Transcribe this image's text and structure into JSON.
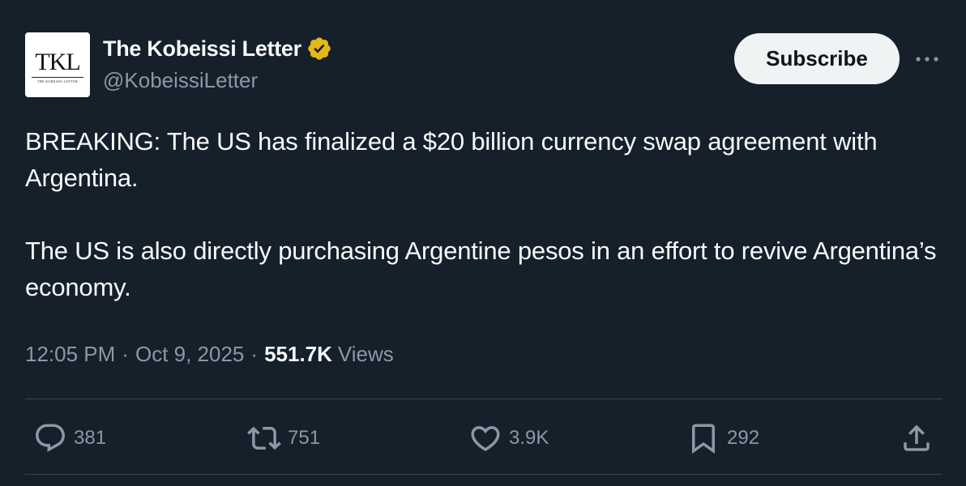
{
  "author": {
    "display_name": "The Kobeissi Letter",
    "handle": "@KobeissiLetter",
    "avatar_logo": "TKL",
    "avatar_logo_sub": "THE KOBEISSI LETTER",
    "verified_icon": "verified-badge-gold",
    "verified_color": "#e2b719"
  },
  "header": {
    "subscribe_label": "Subscribe",
    "more_icon": "more-horizontal-icon"
  },
  "tweet": {
    "paragraphs": [
      "BREAKING: The US has finalized a $20 billion currency swap agreement with Argentina.",
      "The US is also directly purchasing Argentine pesos in an effort to revive Argentina’s economy."
    ]
  },
  "meta": {
    "time": "12:05 PM",
    "separator": "·",
    "date": "Oct 9, 2025",
    "views_count": "551.7K",
    "views_label": "Views"
  },
  "actions": {
    "replies": "381",
    "retweets": "751",
    "likes": "3.9K",
    "bookmarks": "292",
    "icons": [
      "reply-icon",
      "retweet-icon",
      "like-icon",
      "bookmark-icon",
      "share-icon"
    ]
  },
  "colors": {
    "background": "#15202b",
    "primary_text": "#f7f9f9",
    "secondary_text": "#8b98a5",
    "divider": "#38444d",
    "button_bg": "#eff3f4"
  }
}
